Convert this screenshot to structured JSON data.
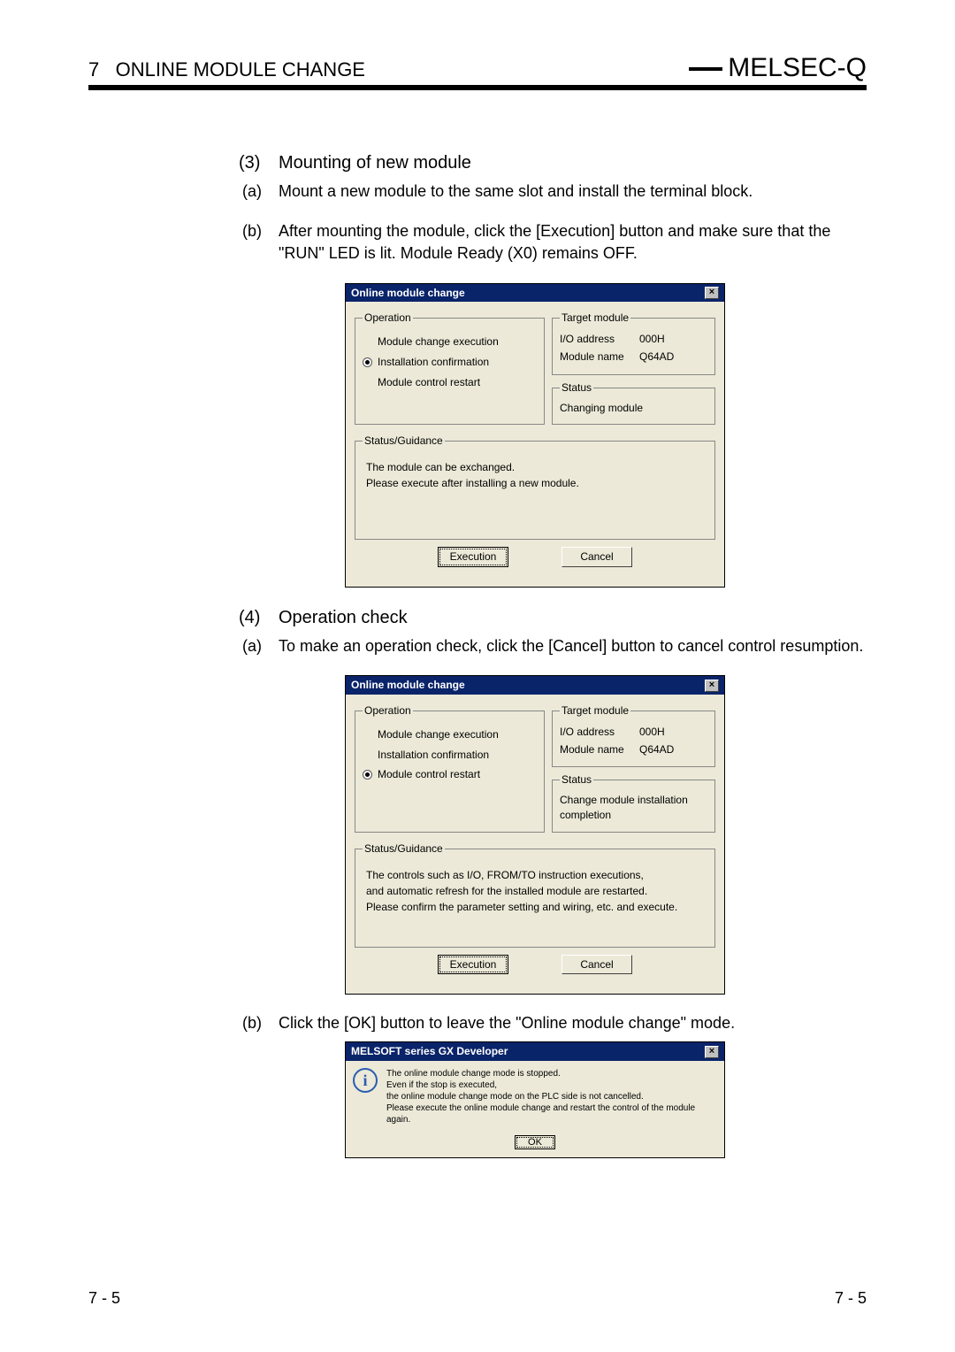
{
  "header": {
    "chapter_num": "7",
    "chapter_title": "ONLINE MODULE CHANGE",
    "series": "MELSEC-Q"
  },
  "section3": {
    "num": "(3)",
    "title": "Mounting of new module",
    "a_lbl": "(a)",
    "a_txt": "Mount a new module to the same slot and install the terminal block.",
    "b_lbl": "(b)",
    "b_txt": "After mounting the module, click the [Execution] button and make sure that the \"RUN\" LED is lit. Module Ready (X0) remains OFF."
  },
  "dlg1": {
    "title": "Online module change",
    "op_legend": "Operation",
    "op1": "Module change execution",
    "op2": "Installation confirmation",
    "op3": "Module control restart",
    "tgt_legend": "Target module",
    "io_k": "I/O address",
    "io_v": "000H",
    "mod_k": "Module name",
    "mod_v": "Q64AD",
    "st_legend": "Status",
    "st_txt": "Changing module",
    "guide_legend": "Status/Guidance",
    "g1": "The module can be exchanged.",
    "g2": "Please execute after installing a new module.",
    "exec": "Execution",
    "cancel": "Cancel"
  },
  "section4": {
    "num": "(4)",
    "title": "Operation check",
    "a_lbl": "(a)",
    "a_txt": "To make an operation check, click the [Cancel] button to cancel control resumption."
  },
  "dlg2": {
    "title": "Online module change",
    "op_legend": "Operation",
    "op1": "Module change execution",
    "op2": "Installation confirmation",
    "op3": "Module control restart",
    "tgt_legend": "Target module",
    "io_k": "I/O address",
    "io_v": "000H",
    "mod_k": "Module name",
    "mod_v": "Q64AD",
    "st_legend": "Status",
    "st_txt": "Change module installation completion",
    "guide_legend": "Status/Guidance",
    "g1": "The controls such as I/O, FROM/TO instruction executions,",
    "g2": "and automatic refresh for the installed module are restarted.",
    "g3": "Please confirm the parameter setting and wiring, etc. and execute.",
    "exec": "Execution",
    "cancel": "Cancel"
  },
  "b_after": {
    "lbl": "(b)",
    "txt": "Click the [OK] button to leave the \"Online module change\" mode."
  },
  "msg": {
    "title": "MELSOFT series GX Developer",
    "l1": "The online module change mode is stopped.",
    "l2": "Even if the stop is executed,",
    "l3": "the online module change mode on the PLC side is not cancelled.",
    "l4": "Please execute the online module change and restart the control of the module again.",
    "ok": "OK"
  },
  "footer": {
    "left": "7 - 5",
    "right": "7 - 5"
  }
}
